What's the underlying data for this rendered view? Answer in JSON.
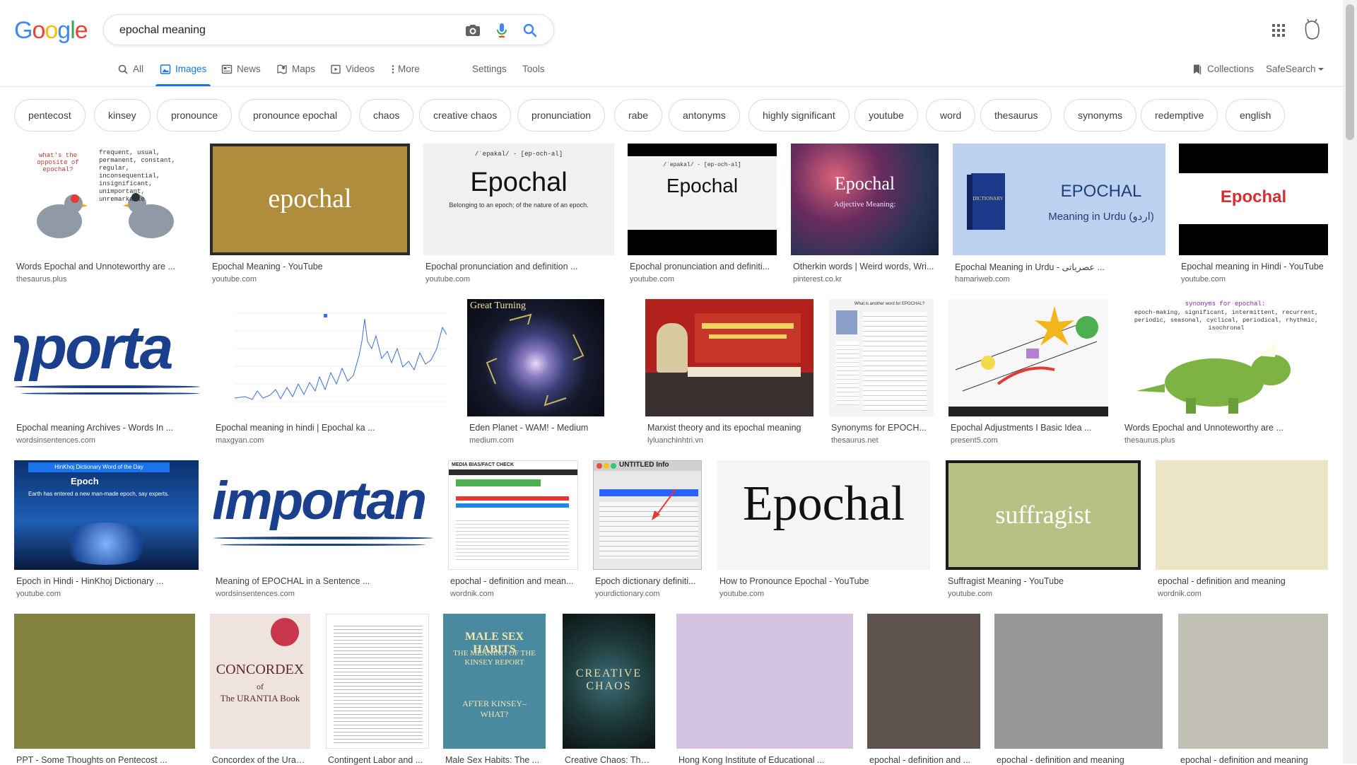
{
  "logo": {
    "letters": [
      "G",
      "o",
      "o",
      "g",
      "l",
      "e"
    ],
    "colors": [
      "#4285f4",
      "#ea4335",
      "#fbbc05",
      "#4285f4",
      "#34a853",
      "#ea4335"
    ]
  },
  "search": {
    "value": "epochal meaning"
  },
  "icons": {
    "camera": "camera-icon",
    "mic": "mic-icon",
    "search": "search-icon",
    "apps": "apps-grid-icon"
  },
  "nav": {
    "tabs": [
      {
        "label": "All",
        "icon": "search-icon"
      },
      {
        "label": "Images",
        "icon": "image-icon",
        "active": true
      },
      {
        "label": "News",
        "icon": "news-icon"
      },
      {
        "label": "Maps",
        "icon": "maps-icon"
      },
      {
        "label": "Videos",
        "icon": "video-icon"
      },
      {
        "label": "More",
        "icon": "dots-icon"
      }
    ],
    "settings": "Settings",
    "tools": "Tools",
    "collections": "Collections",
    "safesearch": "SafeSearch"
  },
  "chips": [
    "pentecost",
    "kinsey",
    "pronounce",
    "pronounce epochal",
    "chaos",
    "creative chaos",
    "pronunciation",
    "rabe",
    "antonyms",
    "highly significant",
    "youtube",
    "word",
    "thesaurus",
    "synonyms",
    "redemptive",
    "english"
  ],
  "results": {
    "row1": [
      {
        "caption": "Words Epochal and Unnoteworthy are ...",
        "source": "thesaurus.plus",
        "thumb_text": "what's the opposite of epochal?"
      },
      {
        "caption": "Epochal Meaning - YouTube",
        "source": "youtube.com",
        "thumb_text": "epochal"
      },
      {
        "caption": "Epochal pronunciation and definition ...",
        "source": "youtube.com",
        "thumb_text": "Epochal"
      },
      {
        "caption": "Epochal pronunciation and definiti...",
        "source": "youtube.com",
        "thumb_text": "Epochal"
      },
      {
        "caption": "Otherkin words | Weird words, Wri...",
        "source": "pinterest.co.kr",
        "thumb_text": "Epochal"
      },
      {
        "caption": "Epochal Meaning in Urdu - عصریاتی ...",
        "source": "hamariweb.com",
        "thumb_text": "EPOCHAL",
        "thumb_sub": "Meaning in Urdu (اردو)"
      },
      {
        "caption": "Epochal meaning in Hindi - YouTube",
        "source": "youtube.com",
        "thumb_text": "Epochal"
      }
    ],
    "row2": [
      {
        "caption": "Epochal meaning Archives - Words In ...",
        "source": "wordsinsentences.com",
        "thumb_text": "ɿporta"
      },
      {
        "caption": "Epochal meaning in hindi | Epochal ka ...",
        "source": "maxgyan.com"
      },
      {
        "caption": "Eden Planet - WAM! - Medium",
        "source": "medium.com",
        "thumb_text": "Great Turning"
      },
      {
        "caption": "Marxist theory and its epochal meaning",
        "source": "lyluanchinhtri.vn"
      },
      {
        "caption": "Synonyms for EPOCH...",
        "source": "thesaurus.net"
      },
      {
        "caption": "Epochal Adjustments I Basic Idea ...",
        "source": "present5.com"
      },
      {
        "caption": "Words Epochal and Unnoteworthy are ...",
        "source": "thesaurus.plus",
        "thumb_text": "synonyms for epochal:"
      }
    ],
    "row3": [
      {
        "caption": "Epoch in Hindi - HinKhoj Dictionary ...",
        "source": "youtube.com",
        "thumb_text": "Epoch"
      },
      {
        "caption": "Meaning of EPOCHAL in a Sentence ...",
        "source": "wordsinsentences.com",
        "thumb_text": "importan"
      },
      {
        "caption": "epochal - definition and mean...",
        "source": "wordnik.com",
        "thumb_text": "MEDIA BIAS/FACT CHECK"
      },
      {
        "caption": "Epoch dictionary definiti...",
        "source": "yourdictionary.com",
        "thumb_text": "UNTITLED Info"
      },
      {
        "caption": "How to Pronounce Epochal - YouTube",
        "source": "youtube.com",
        "thumb_text": "Epochal"
      },
      {
        "caption": "Suffragist Meaning - YouTube",
        "source": "youtube.com",
        "thumb_text": "suffragist"
      },
      {
        "caption": "epochal - definition and meaning",
        "source": "wordnik.com"
      }
    ],
    "row4": [
      {
        "caption": "PPT - Some Thoughts on Pentecost ..."
      },
      {
        "caption": "Concordex of the Uran...",
        "thumb_text": "CONCORDEX",
        "thumb_sub": "The URANTIA Book"
      },
      {
        "caption": "Contingent Labor and ..."
      },
      {
        "caption": "Male Sex Habits: The ...",
        "thumb_text": "MALE SEX HABITS"
      },
      {
        "caption": "Creative Chaos: The ...",
        "thumb_text": "CREATIVE CHAOS"
      },
      {
        "caption": "Hong Kong Institute of Educational ..."
      },
      {
        "caption": "epochal - definition and ..."
      },
      {
        "caption": "epochal - definition and meaning"
      },
      {
        "caption": "epochal - definition and meaning"
      }
    ]
  }
}
